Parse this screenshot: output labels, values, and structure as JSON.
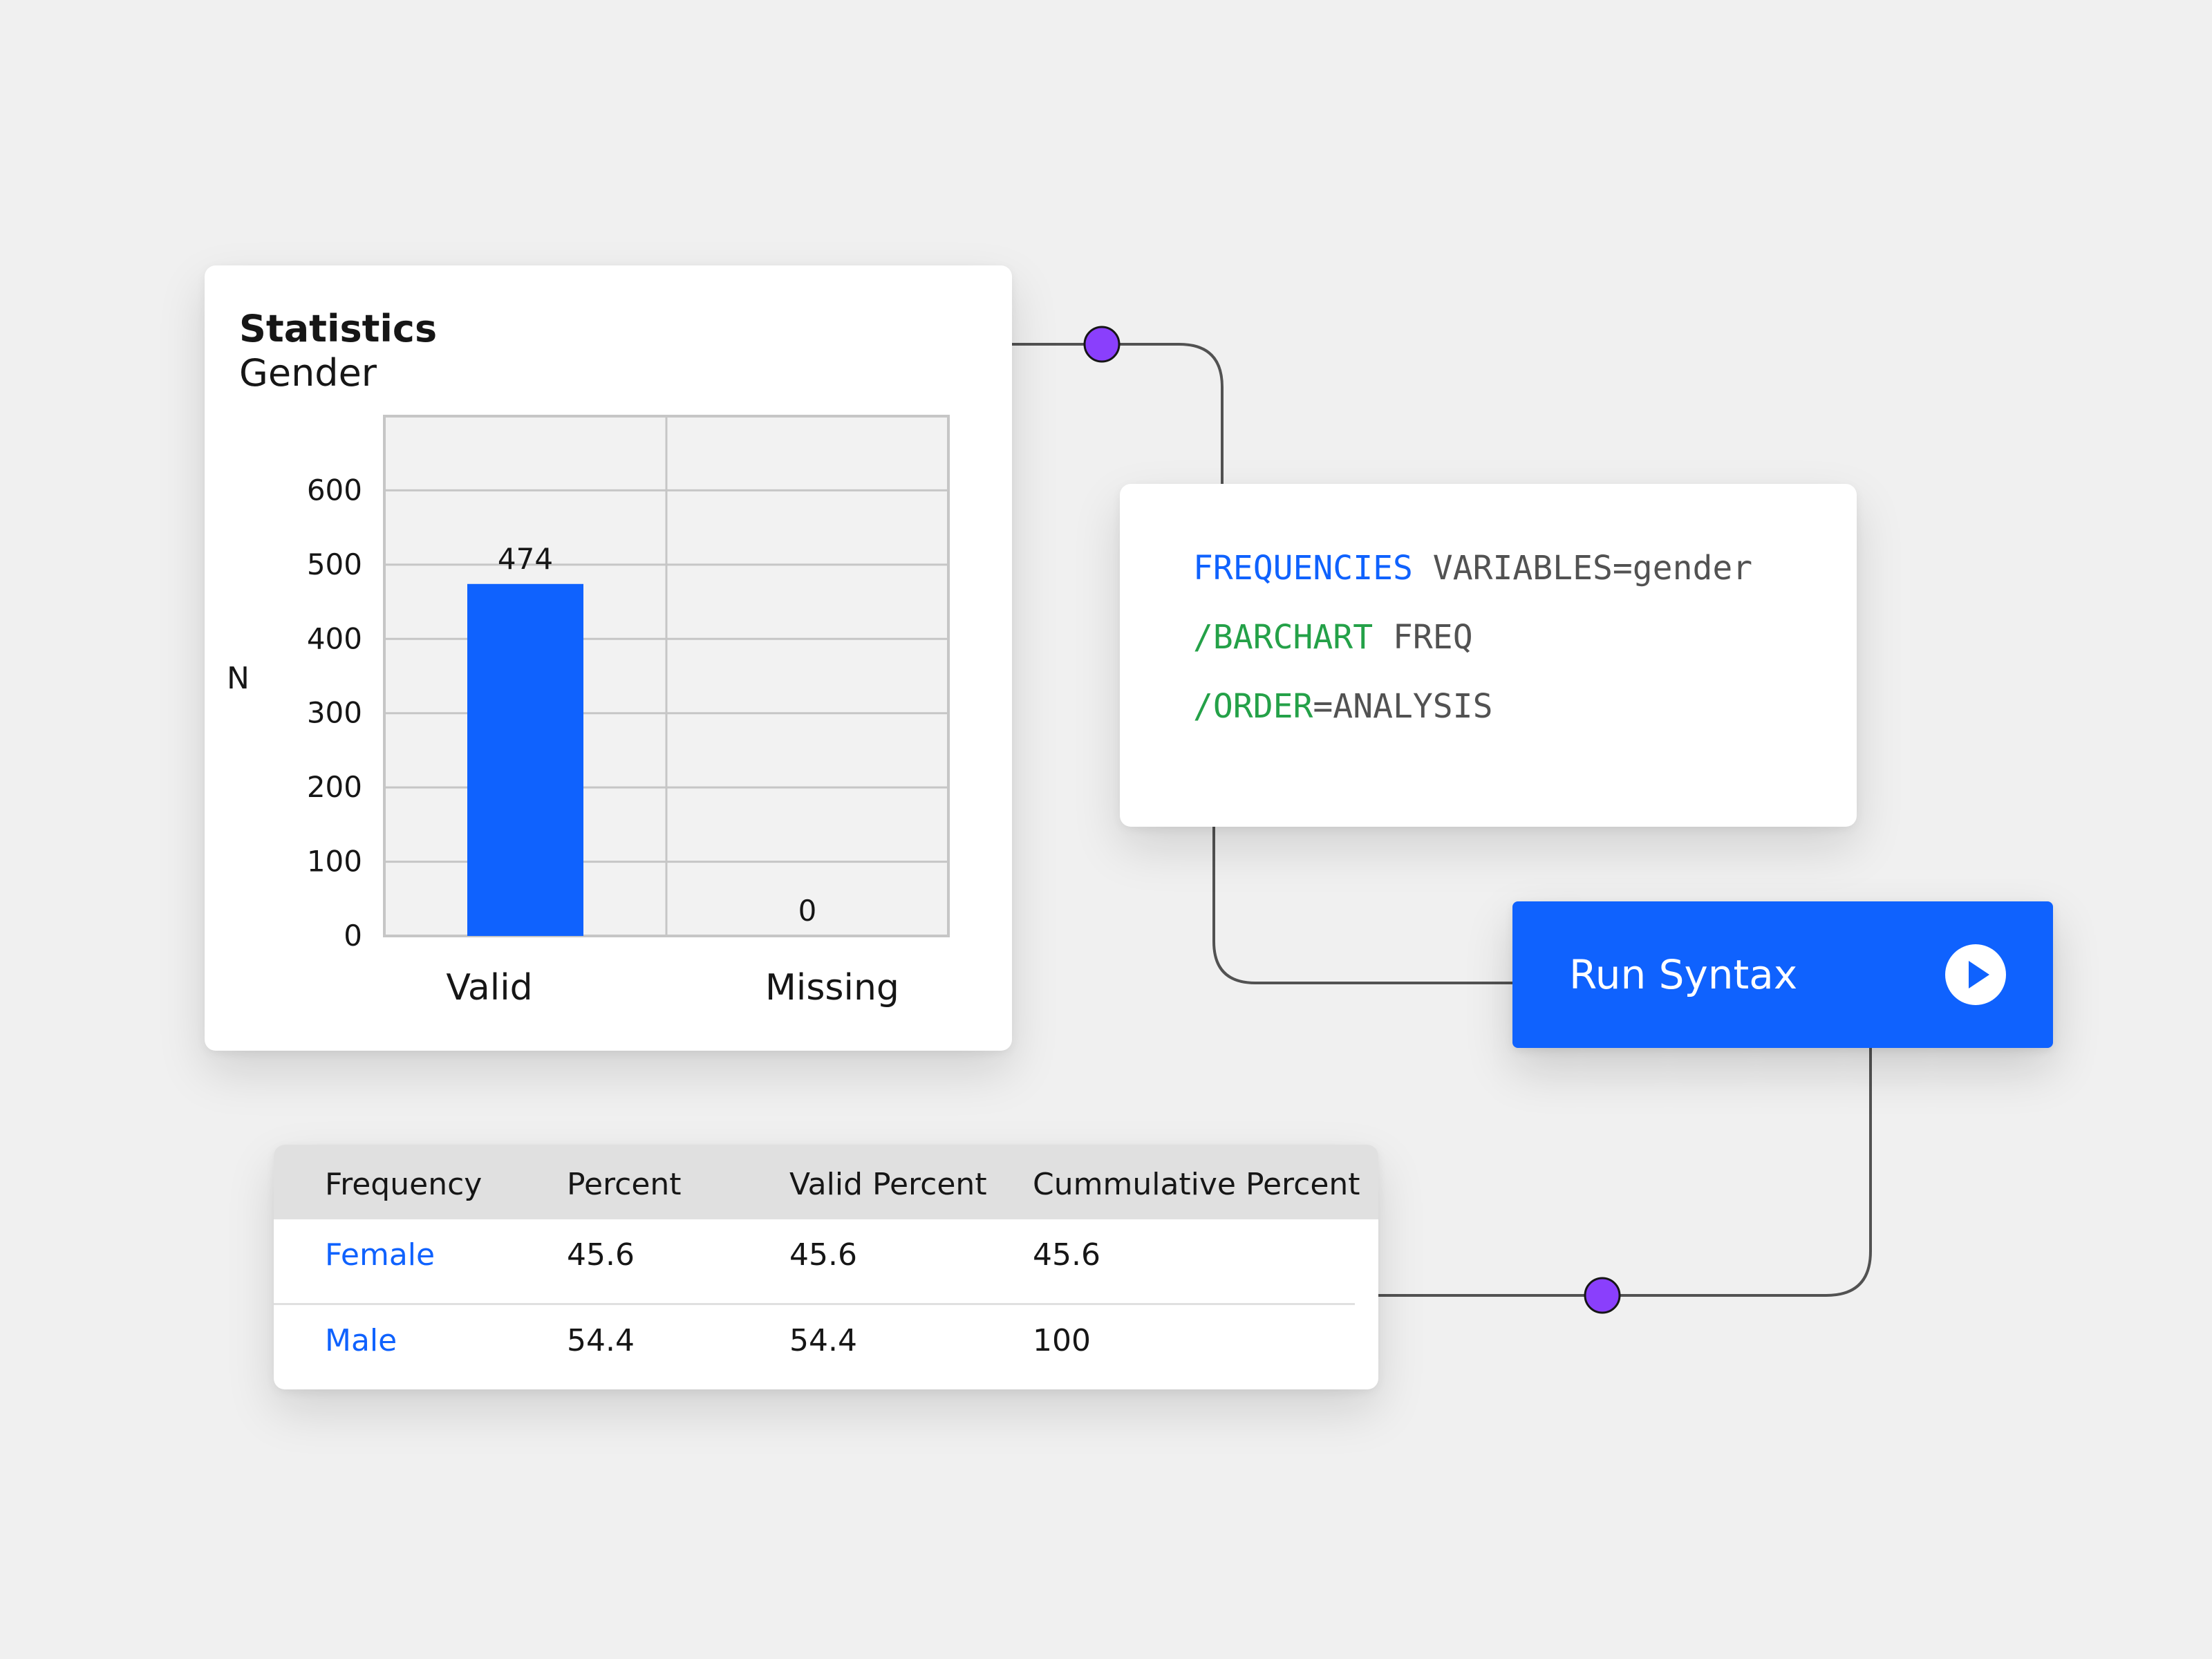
{
  "stats_card": {
    "title": "Statistics",
    "subtitle": "Gender"
  },
  "chart_data": {
    "type": "bar",
    "title": "Statistics",
    "subtitle": "Gender",
    "ylabel": "N",
    "xlabel": "",
    "categories": [
      "Valid",
      "Missing"
    ],
    "values": [
      474,
      0
    ],
    "data_labels": [
      "474",
      "0"
    ],
    "ylim": [
      0,
      700
    ],
    "yticks": [
      0,
      100,
      200,
      300,
      400,
      500,
      600
    ],
    "grid": true,
    "legend": "none",
    "bar_color": "#0f62fe"
  },
  "syntax": {
    "line1_keyword": "FREQUENCIES",
    "line1_rest": " VARIABLES=gender",
    "line2_keyword": "/BARCHART",
    "line2_rest": " FREQ",
    "line3_keyword": "/ORDER",
    "line3_rest": "=ANALYSIS"
  },
  "run_button": {
    "label": "Run Syntax",
    "icon": "play-icon"
  },
  "freq_table": {
    "headers": [
      "Frequency",
      "Percent",
      "Valid Percent",
      "Cummulative Percent"
    ],
    "rows": [
      {
        "label": "Female",
        "percent": "45.6",
        "valid_percent": "45.6",
        "cumulative_percent": "45.6"
      },
      {
        "label": "Male",
        "percent": "54.4",
        "valid_percent": "54.4",
        "cumulative_percent": "100"
      }
    ]
  },
  "colors": {
    "accent": "#0f62fe",
    "keyword_green": "#24a148",
    "connector_node": "#8a3ffc",
    "background": "#f0f0f0"
  }
}
